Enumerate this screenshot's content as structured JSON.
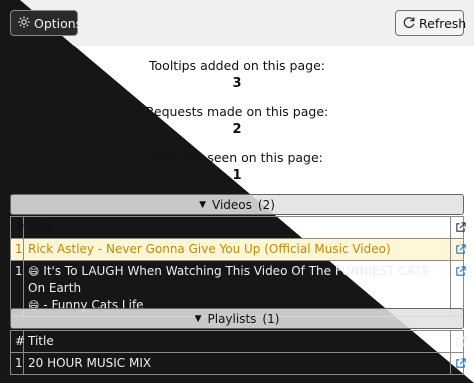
{
  "toolbar": {
    "options_label": "Options",
    "refresh_label": "Refresh"
  },
  "stats": [
    {
      "label": "Tooltips added on this page:",
      "value": "3"
    },
    {
      "label": "Requests made on this page:",
      "value": "2"
    },
    {
      "label": "Rickrolls seen on this page:",
      "value": "1"
    }
  ],
  "videos": {
    "header": "Videos",
    "count": "(2)",
    "columns": {
      "num": "#",
      "title": "Title"
    },
    "rows": [
      {
        "num": "1",
        "title": "Rick Astley - Never Gonna Give You Up (Official Music Video)"
      },
      {
        "num": "1",
        "title_line1": "It's To LAUGH When Watching This Video Of The FUNNIEST CATS On Earth",
        "title_line2": "- Funny Cats Life"
      }
    ]
  },
  "playlists": {
    "header": "Playlists",
    "count": "(1)",
    "columns": {
      "num": "#",
      "title": "Title"
    },
    "rows": [
      {
        "num": "1",
        "title": "20 HOUR MUSIC MIX"
      }
    ]
  },
  "colors": {
    "dark_bg": "#161616",
    "light_bg": "#ffffff",
    "highlight_row": "#fff6d6",
    "link_icon": "#1a73c8"
  },
  "icons": [
    "gear-icon",
    "refresh-icon",
    "triangle-down-icon",
    "external-link-icon",
    "laughing-emoji-icon"
  ]
}
